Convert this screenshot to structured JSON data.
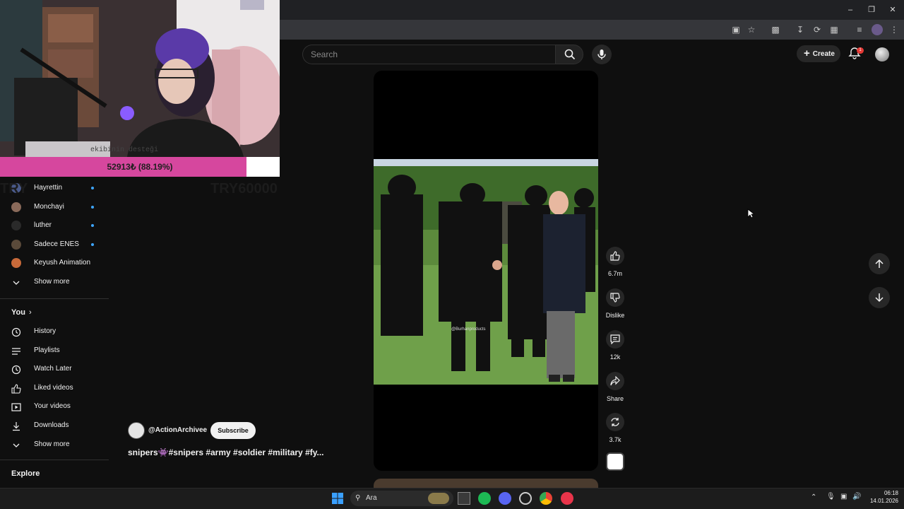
{
  "browser": {
    "window_controls": [
      "minimize",
      "restore",
      "close"
    ]
  },
  "header": {
    "search_placeholder": "Search",
    "create_label": "Create",
    "notifications_count": "1"
  },
  "stream_overlay": {
    "donation_progress_text": "52913₺ (88.19%)",
    "donation_progress_fraction": 0.8819,
    "goal_left_text": "TRY",
    "goal_right_text": "TRY60000",
    "webcam_caption": "ekibinin desteği"
  },
  "sidebar": {
    "subscriptions": [
      {
        "label": "Hayrettin",
        "avatar_color": "#4a5a8a",
        "live_dot": true
      },
      {
        "label": "Monchayi",
        "avatar_color": "#8a6a5a",
        "live_dot": true
      },
      {
        "label": "luther",
        "avatar_color": "#2a2a2a",
        "live_dot": true
      },
      {
        "label": "Sadece ENES",
        "avatar_color": "#5a4a3a",
        "live_dot": true
      },
      {
        "label": "Keyush Animation",
        "avatar_color": "#c86a3a",
        "live_dot": false
      }
    ],
    "show_more_1": "Show more",
    "you_heading": "You",
    "you_items": [
      {
        "label": "History",
        "icon": "history-icon"
      },
      {
        "label": "Playlists",
        "icon": "playlists-icon"
      },
      {
        "label": "Watch Later",
        "icon": "watch-later-icon"
      },
      {
        "label": "Liked videos",
        "icon": "liked-icon"
      },
      {
        "label": "Your videos",
        "icon": "your-videos-icon"
      },
      {
        "label": "Downloads",
        "icon": "download-icon"
      }
    ],
    "show_more_2": "Show more",
    "explore_heading": "Explore"
  },
  "short": {
    "watermark": "@Burhanproducts",
    "channel_handle": "@ActionArchivee",
    "subscribe_label": "Subscribe",
    "title": "snipers👾#snipers #army #soldier #military #fy..."
  },
  "actions": {
    "like_count": "6.7m",
    "dislike_label": "Dislike",
    "comments_count": "12k",
    "share_label": "Share",
    "remix_count": "3.7k"
  },
  "taskbar": {
    "search_label": "Ara",
    "time": "06:18",
    "date": "14.01.2026"
  },
  "colors": {
    "youtube_bg": "#0f0f0f",
    "donation_bar": "#d6479e",
    "notif_badge": "#e53935",
    "live_dot": "#3ea6ff"
  }
}
